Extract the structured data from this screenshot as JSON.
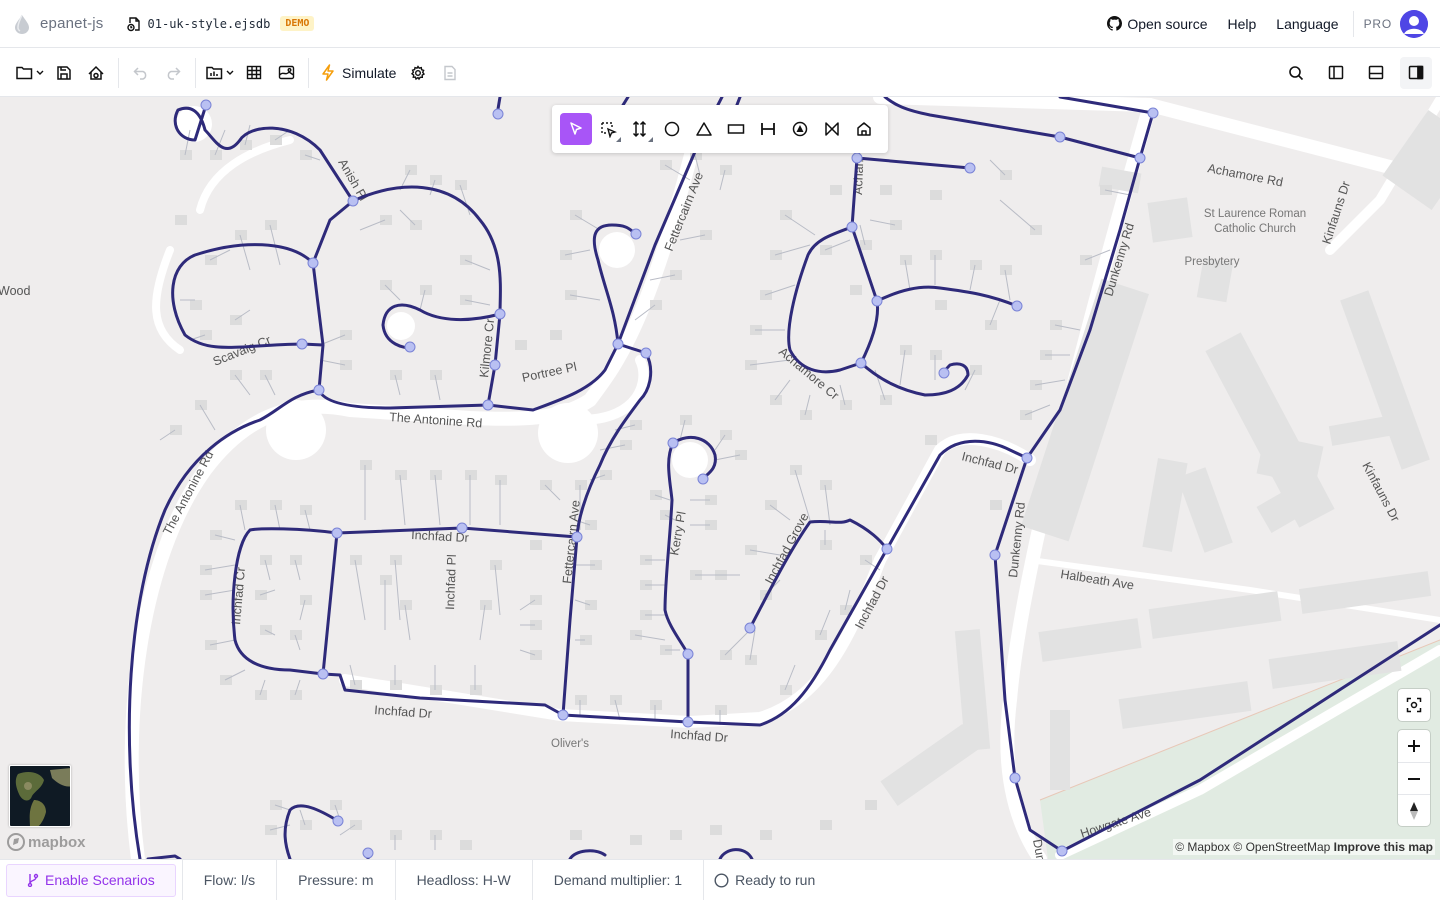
{
  "header": {
    "app_name": "epanet-js",
    "file_name": "01-uk-style.ejsdb",
    "badge": "DEMO",
    "links": {
      "open_source": "Open source",
      "help": "Help",
      "language": "Language"
    },
    "plan": "PRO"
  },
  "toolbar": {
    "simulate_label": "Simulate",
    "buttons": [
      "folder-menu",
      "save",
      "save-as",
      "undo",
      "redo",
      "import-menu",
      "table",
      "layers",
      "simulate",
      "settings",
      "report"
    ],
    "right_buttons": [
      "search",
      "left-panel",
      "bottom-panel",
      "right-panel"
    ]
  },
  "draw_tools": [
    "select",
    "lasso-select",
    "redraw",
    "junction",
    "reservoir",
    "tank",
    "pipe",
    "pump",
    "valve",
    "customer-point"
  ],
  "map": {
    "street_labels": {
      "anish_pl": "Anish Pl",
      "achamore_rd": "Achamore Rd",
      "kinfauns_dr_top": "Kinfauns Dr",
      "st_laurence": "St Laurence Roman",
      "catholic_church": "Catholic Church",
      "presbytery": "Presbytery",
      "dunkenny_rd_top": "Dunkenny Rd",
      "fettercairn_ave_top": "Fettercairn Ave",
      "achamore_short": "Achan",
      "kilmore_cr": "Kilmore Cr",
      "portree_pl": "Portree Pl",
      "scavaig_cr": "Scavaig Cr",
      "the_antonine_rd_1": "The Antonine Rd",
      "the_antonine_rd_2": "The Antonine Rd",
      "achamore_cr": "Achamore Cr",
      "inchfad_dr_east": "Inchfad Dr",
      "kinfauns_dr_right": "Kinfauns Dr",
      "inchfad_dr_mid": "Inchfad Dr",
      "inchfad_cr": "Inchfad Cr",
      "inchfad_pl": "Inchfad Pl",
      "fettercairn_ave_low": "Fettercairn Ave",
      "kerry_pl": "Kerry Pl",
      "inchfad_grove": "Inchfad Grove",
      "inchfad_dr_diag": "Inchfad Dr",
      "dunkenny_rd_low": "Dunkenny Rd",
      "halbeath_ave": "Halbeath Ave",
      "inchfad_dr_bottom": "Inchfad Dr",
      "olivers": "Oliver's",
      "inchfad_dr_bottom2": "Inchfad Dr",
      "howgate_ave": "Howgate Ave",
      "wood": "Wood",
      "dunk": "Dunk"
    },
    "attribution": {
      "mapbox": "© Mapbox",
      "osm": "© OpenStreetMap",
      "improve": "Improve this map"
    },
    "mapbox_logo": "mapbox",
    "colors": {
      "pipe": "#2e2a7a",
      "junction": "#b9c0f2",
      "accent": "#a855f7"
    }
  },
  "footer": {
    "scenarios_label": "Enable Scenarios",
    "flow": "Flow: l/s",
    "pressure": "Pressure: m",
    "headloss": "Headloss: H-W",
    "demand": "Demand multiplier: 1",
    "status": "Ready to run"
  }
}
